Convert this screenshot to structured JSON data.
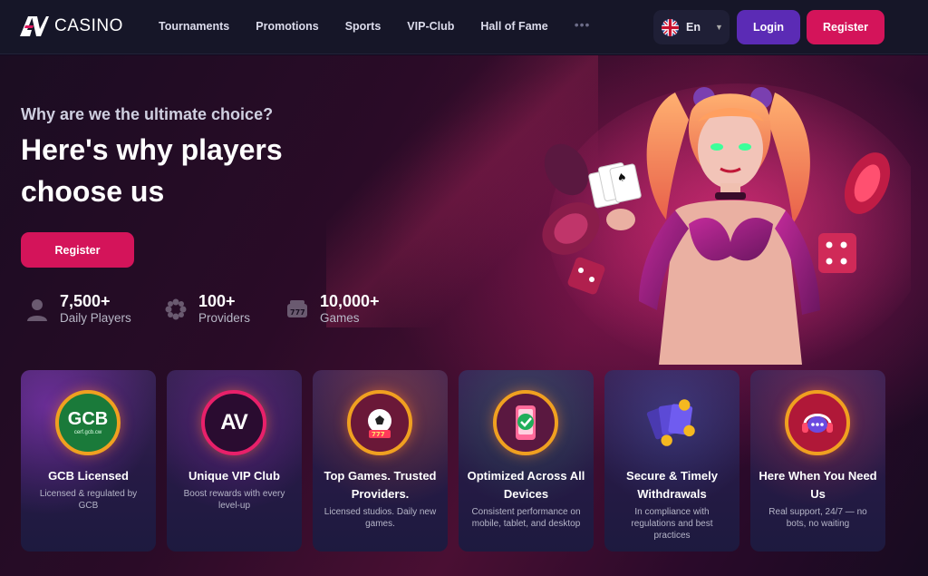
{
  "header": {
    "brand": "CASINO",
    "nav": [
      "Tournaments",
      "Promotions",
      "Sports",
      "VIP-Club",
      "Hall of Fame"
    ],
    "more": "•••",
    "language": "En",
    "login_label": "Login",
    "register_label": "Register"
  },
  "hero": {
    "subtitle": "Why are we the ultimate choice?",
    "headline": "Here's why players choose us",
    "register_label": "Register",
    "stats": [
      {
        "value": "7,500+",
        "label": "Daily Players",
        "icon": "user-icon"
      },
      {
        "value": "100+",
        "label": "Providers",
        "icon": "providers-icon"
      },
      {
        "value": "10,000+",
        "label": "Games",
        "icon": "slot-777-icon"
      }
    ]
  },
  "cards": [
    {
      "title": "GCB Licensed",
      "desc": "Licensed & regulated by GCB",
      "icon": "gcb-license-icon",
      "badge": "GCB",
      "badge_sub": "cerf.gcb.cw"
    },
    {
      "title": "Unique VIP Club",
      "desc": "Boost rewards with every level-up",
      "icon": "vip-logo-icon",
      "badge": "AV"
    },
    {
      "title": "Top Games. Trusted Providers.",
      "desc": "Licensed studios. Daily new games.",
      "icon": "soccer-slot-icon"
    },
    {
      "title": "Optimized Across All Devices",
      "desc": "Consistent performance on mobile, tablet, and desktop",
      "icon": "phone-check-icon"
    },
    {
      "title": "Secure & Timely Withdrawals",
      "desc": "In compliance with regulations and best practices",
      "icon": "cards-coins-icon"
    },
    {
      "title": "Here When You Need Us",
      "desc": "Real support, 24/7 — no bots, no waiting",
      "icon": "support-chat-icon"
    }
  ],
  "colors": {
    "accent": "#d4145a",
    "login": "#5b2bb5",
    "ring": "#f0a020"
  }
}
